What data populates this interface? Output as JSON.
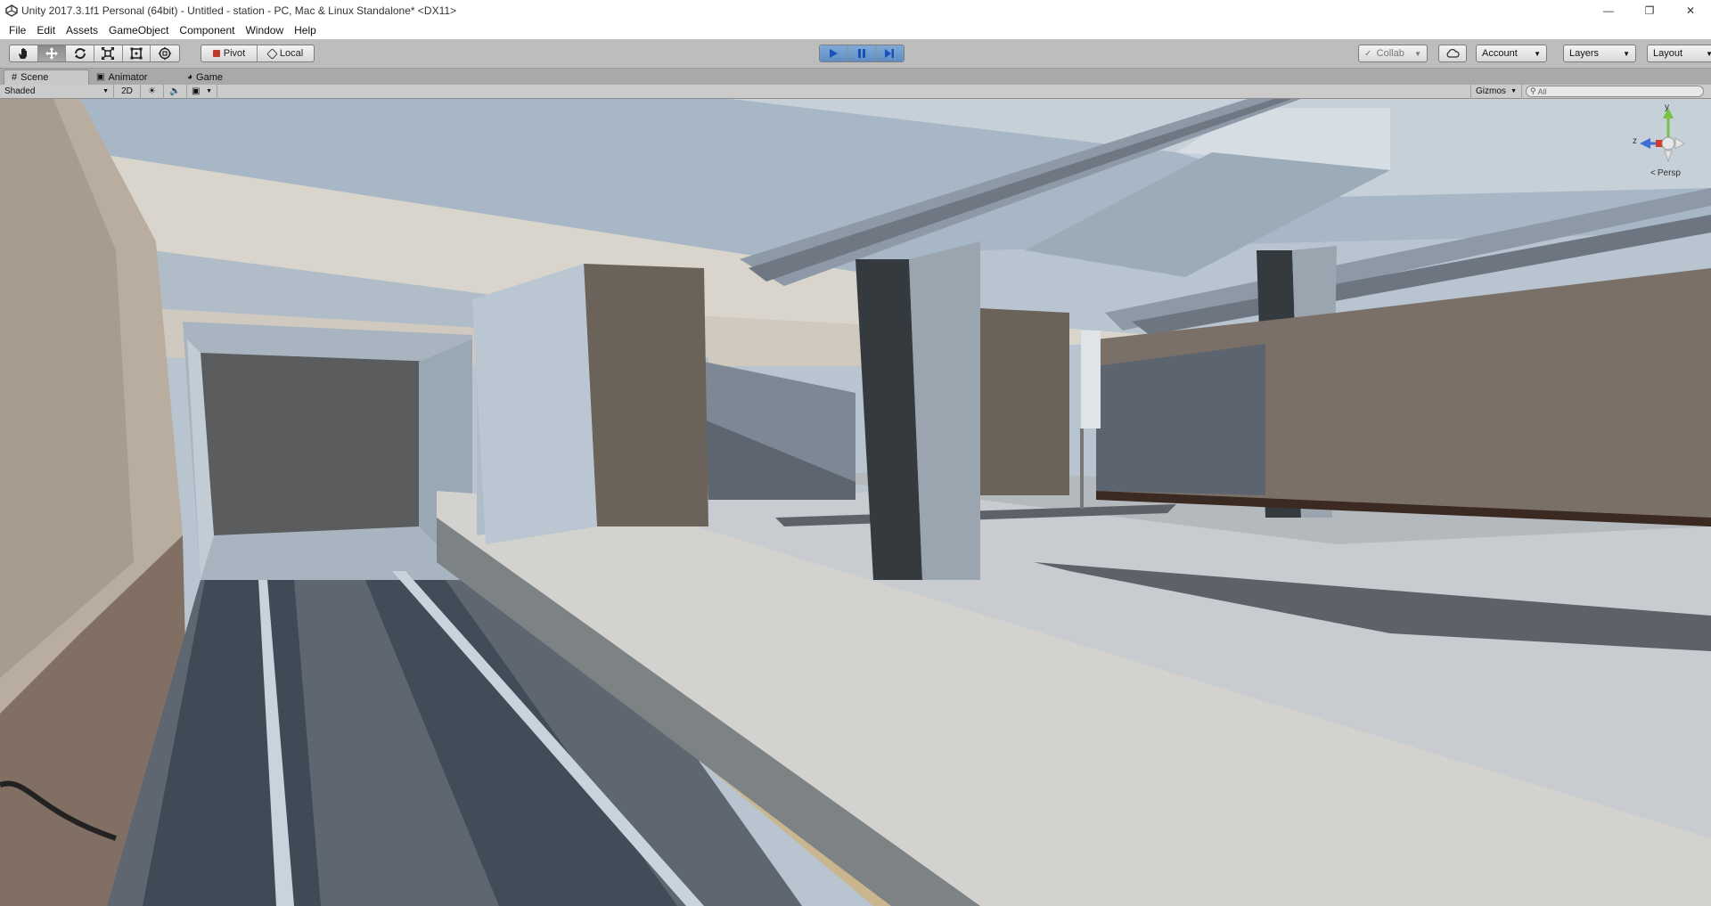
{
  "window": {
    "title": "Unity 2017.3.1f1 Personal (64bit) - Untitled - station - PC, Mac & Linux Standalone* <DX11>",
    "icons": {
      "app": "unity-logo-icon",
      "minimize": "minimize-icon",
      "maximize": "restore-icon",
      "close": "close-icon"
    }
  },
  "menu": [
    "File",
    "Edit",
    "Assets",
    "GameObject",
    "Component",
    "Window",
    "Help"
  ],
  "toolbar": {
    "transform_tools": [
      "hand-tool-icon",
      "move-tool-icon",
      "rotate-tool-icon",
      "scale-tool-icon",
      "rect-tool-icon",
      "transform-tool-icon"
    ],
    "active_tool": "move-tool-icon",
    "pivot_label": "Pivot",
    "local_label": "Local",
    "play_controls": [
      "play-icon",
      "pause-icon",
      "step-icon"
    ],
    "collab_label": "Collab",
    "account_label": "Account",
    "layers_label": "Layers",
    "layout_label": "Layout"
  },
  "tabs": [
    {
      "label": "Scene",
      "icon": "scene-icon",
      "active": true
    },
    {
      "label": "Animator",
      "icon": "animator-icon",
      "active": false
    },
    {
      "label": "Game",
      "icon": "game-icon",
      "active": false
    }
  ],
  "scene_toolbar": {
    "draw_mode": "Shaded",
    "mode_2d": "2D",
    "gizmos_label": "Gizmos",
    "search_placeholder": "All"
  },
  "gizmo": {
    "axis_y": "y",
    "axis_z": "z",
    "projection_label": "Persp"
  },
  "colors": {
    "play_accent": "#5f8ec4",
    "axis_x": "#d23b2b",
    "axis_y": "#7bc243",
    "axis_z": "#3d6fd6"
  }
}
